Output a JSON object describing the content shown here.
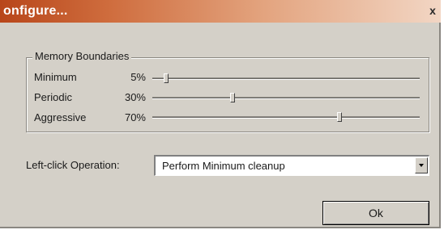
{
  "window": {
    "title": "onfigure...",
    "close_glyph": "x"
  },
  "memory_boundaries": {
    "label": "Memory Boundaries",
    "rows": [
      {
        "label": "Minimum",
        "percent_text": "5%",
        "value": 5
      },
      {
        "label": "Periodic",
        "percent_text": "30%",
        "value": 30
      },
      {
        "label": "Aggressive",
        "percent_text": "70%",
        "value": 70
      }
    ]
  },
  "left_click": {
    "label": "Left-click Operation:",
    "selected": "Perform Minimum cleanup"
  },
  "ok_button": {
    "label": "Ok"
  },
  "colors": {
    "title_start": "#b8461a",
    "dialog_bg": "#d4d0c8"
  },
  "icons": {
    "dropdown": "chevron-down-icon"
  }
}
